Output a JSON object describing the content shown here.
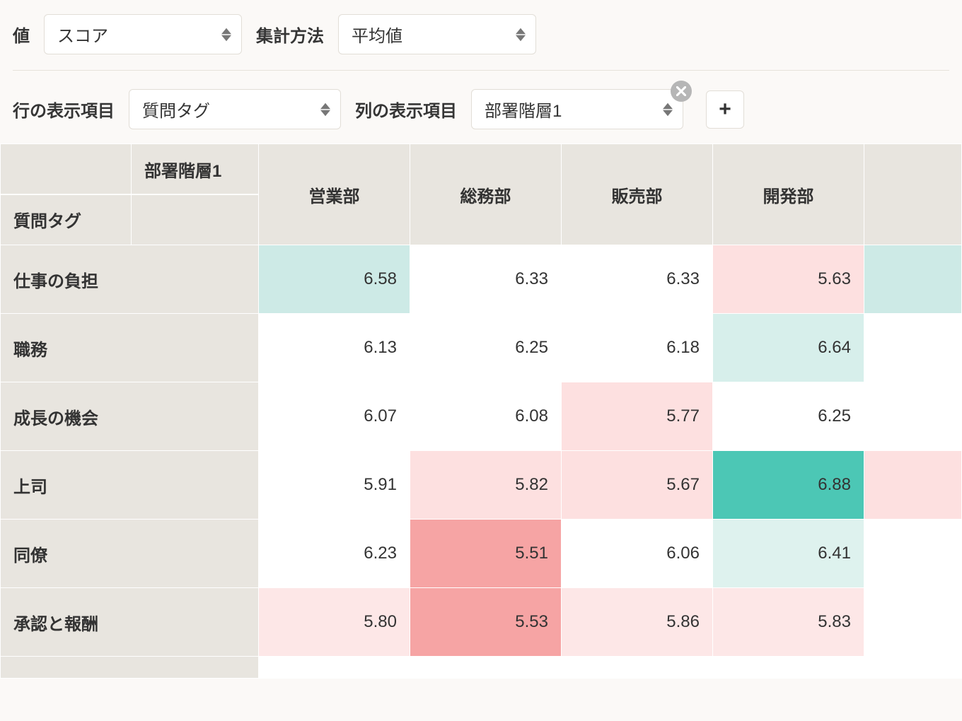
{
  "controls": {
    "value_label": "値",
    "value_select": "スコア",
    "agg_label": "集計方法",
    "agg_select": "平均値",
    "row_label": "行の表示項目",
    "row_select": "質問タグ",
    "col_label": "列の表示項目",
    "col_select": "部署階層1",
    "add_label": "+"
  },
  "table": {
    "corner_top": "部署階層1",
    "corner_bottom": "質問タグ",
    "columns": [
      "営業部",
      "総務部",
      "販売部",
      "開発部"
    ],
    "rows": [
      {
        "label": "仕事の負担",
        "cells": [
          {
            "v": "6.58",
            "c": "#cdeae6"
          },
          {
            "v": "6.33",
            "c": "#ffffff"
          },
          {
            "v": "6.33",
            "c": "#ffffff"
          },
          {
            "v": "5.63",
            "c": "#fde0e0"
          }
        ],
        "tail": "#cdeae6"
      },
      {
        "label": "職務",
        "cells": [
          {
            "v": "6.13",
            "c": "#ffffff"
          },
          {
            "v": "6.25",
            "c": "#ffffff"
          },
          {
            "v": "6.18",
            "c": "#ffffff"
          },
          {
            "v": "6.64",
            "c": "#d7efeb"
          }
        ],
        "tail": "#ffffff"
      },
      {
        "label": "成長の機会",
        "cells": [
          {
            "v": "6.07",
            "c": "#ffffff"
          },
          {
            "v": "6.08",
            "c": "#ffffff"
          },
          {
            "v": "5.77",
            "c": "#fde0e0"
          },
          {
            "v": "6.25",
            "c": "#ffffff"
          }
        ],
        "tail": "#ffffff"
      },
      {
        "label": "上司",
        "cells": [
          {
            "v": "5.91",
            "c": "#ffffff"
          },
          {
            "v": "5.82",
            "c": "#fde0e0"
          },
          {
            "v": "5.67",
            "c": "#fde0e0"
          },
          {
            "v": "6.88",
            "c": "#4cc7b5"
          }
        ],
        "tail": "#fde0e0"
      },
      {
        "label": "同僚",
        "cells": [
          {
            "v": "6.23",
            "c": "#ffffff"
          },
          {
            "v": "5.51",
            "c": "#f6a4a4"
          },
          {
            "v": "6.06",
            "c": "#ffffff"
          },
          {
            "v": "6.41",
            "c": "#def2ee"
          }
        ],
        "tail": "#ffffff"
      },
      {
        "label": "承認と報酬",
        "cells": [
          {
            "v": "5.80",
            "c": "#fde7e7"
          },
          {
            "v": "5.53",
            "c": "#f6a4a4"
          },
          {
            "v": "5.86",
            "c": "#fde7e7"
          },
          {
            "v": "5.83",
            "c": "#fde7e7"
          }
        ],
        "tail": "#ffffff"
      }
    ]
  },
  "chart_data": {
    "type": "heatmap",
    "title": "",
    "xlabel": "部署階層1",
    "ylabel": "質問タグ",
    "x_categories": [
      "営業部",
      "総務部",
      "販売部",
      "開発部"
    ],
    "y_categories": [
      "仕事の負担",
      "職務",
      "成長の機会",
      "上司",
      "同僚",
      "承認と報酬"
    ],
    "values": [
      [
        6.58,
        6.33,
        6.33,
        5.63
      ],
      [
        6.13,
        6.25,
        6.18,
        6.64
      ],
      [
        6.07,
        6.08,
        5.77,
        6.25
      ],
      [
        5.91,
        5.82,
        5.67,
        6.88
      ],
      [
        6.23,
        5.51,
        6.06,
        6.41
      ],
      [
        5.8,
        5.53,
        5.86,
        5.83
      ]
    ],
    "value_metric": "スコア",
    "aggregation": "平均値"
  }
}
